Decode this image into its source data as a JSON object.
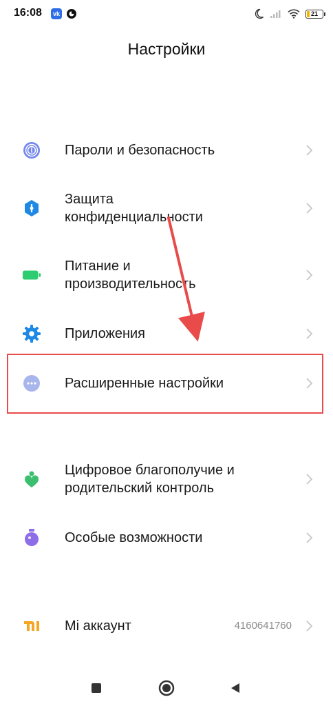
{
  "status_bar": {
    "time": "16:08",
    "notification_vk_icon": "vk-icon",
    "notification_ring_icon": "ring-app-icon",
    "moon_icon": "moon-icon",
    "signal_icon": "signal-icon",
    "wifi_icon": "wifi-icon",
    "battery_level": "21",
    "battery_fraction": 0.21
  },
  "header": {
    "title": "Настройки"
  },
  "settings": [
    {
      "label": "Пароли и безопасность",
      "icon": "fingerprint-icon",
      "icon_color": "#6b7df0"
    },
    {
      "label_line1": "Защита",
      "label_line2": "конфиденциальности",
      "icon": "privacy-shield-icon",
      "icon_color": "#1e88e5"
    },
    {
      "label_line1": "Питание и",
      "label_line2": "производительность",
      "icon": "battery-icon",
      "icon_color": "#2ecc71"
    },
    {
      "label": "Приложения",
      "icon": "gear-icon",
      "icon_color": "#1e88e5"
    },
    {
      "label": "Расширенные настройки",
      "icon": "more-dots-icon",
      "icon_color": "#a9b6ec"
    },
    {
      "label_line1": "Цифровое благополучие и",
      "label_line2": "родительский контроль",
      "icon": "wellbeing-heart-icon",
      "icon_color": "#3cbf6f"
    },
    {
      "label": "Особые возможности",
      "icon": "accessibility-flask-icon",
      "icon_color": "#8e6de8"
    },
    {
      "label": "Mi аккаунт",
      "value": "4160641760",
      "icon": "mi-logo-icon",
      "icon_color": "#f5a623"
    }
  ],
  "nav": {
    "recents_icon": "square-icon",
    "home_icon": "circle-home-icon",
    "back_icon": "triangle-back-icon"
  },
  "colors": {
    "highlight": "#e94a4a",
    "chevron": "#c6c6c6"
  }
}
